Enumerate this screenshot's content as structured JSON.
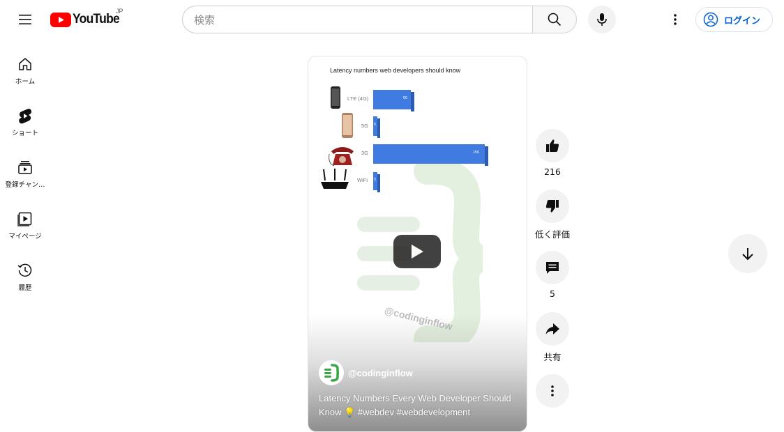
{
  "header": {
    "logo_text": "YouTube",
    "region": "JP",
    "search_placeholder": "検索",
    "login_label": "ログイン",
    "accent_color": "#ff0000"
  },
  "sidebar": {
    "items": [
      {
        "label": "ホーム",
        "icon": "home-icon"
      },
      {
        "label": "ショート",
        "icon": "shorts-icon"
      },
      {
        "label": "登録チャン…",
        "icon": "subscriptions-icon"
      },
      {
        "label": "マイページ",
        "icon": "library-icon"
      },
      {
        "label": "履歴",
        "icon": "history-icon"
      }
    ]
  },
  "short": {
    "chart_title": "Latency numbers web developers should know",
    "rows": [
      {
        "label": "LTE (4G)",
        "value": "50",
        "fraction": 0.33,
        "icon": "smartphone-icon"
      },
      {
        "label": "5G",
        "value": "5",
        "fraction": 0.033,
        "icon": "smartphone-icon"
      },
      {
        "label": "3G",
        "value": "150",
        "fraction": 1.0,
        "icon": "telephone-icon"
      },
      {
        "label": "WiFi",
        "value": "5",
        "fraction": 0.033,
        "icon": "router-icon"
      }
    ],
    "watermark": "@codinginflow",
    "channel_handle": "@codinginflow",
    "title": "Latency Numbers Every Web Developer Should Know 💡 #webdev #webdevelopment"
  },
  "actions": {
    "like_count": "216",
    "dislike_label": "低く評価",
    "comment_count": "5",
    "share_label": "共有"
  }
}
